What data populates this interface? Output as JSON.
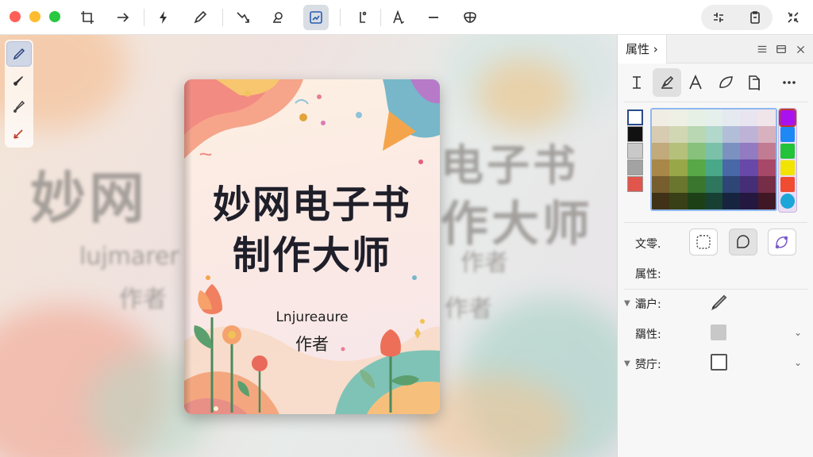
{
  "toolbar": {
    "buttons": [
      "crop-icon",
      "arrow-right-icon",
      "lightning-icon",
      "pen-icon",
      "arrow-corner-icon",
      "eraser-icon",
      "shape-tool-icon",
      "measure-icon",
      "text-style-icon",
      "line-icon",
      "mask-icon"
    ],
    "active": "shape-tool-icon",
    "right_segment": [
      "adjust-icon",
      "clipboard-icon"
    ],
    "close_icon": "collapse-icon"
  },
  "left_tools": [
    "brush-tool-icon",
    "thin-brush-icon",
    "airbrush-icon",
    "pen-nib-icon"
  ],
  "book": {
    "title_line1": "妙网电子书",
    "title_line2": "制作大师",
    "author_latin": "Lnjureaure",
    "author": "作者"
  },
  "background_echo": {
    "title_left": "妙网",
    "title_right_top": "电子书",
    "title_right_bottom": "作大师",
    "sub_left": "lujmarer",
    "sub_right": "作者",
    "sub_left2": "作者",
    "sub_right2": "作者"
  },
  "panel": {
    "tab_label": "属性 ›",
    "header_icons": [
      "menu-icon",
      "close-panel-icon"
    ],
    "tools": [
      "text-cursor-icon",
      "paint-tool-icon",
      "font-icon",
      "leaf-shape-icon",
      "page-icon",
      "more-icon"
    ],
    "active_tool": "paint-tool-icon",
    "text_label": "文零.",
    "attr_label": "属性:",
    "section1_label": "灞户:",
    "section2_label": "羂性:",
    "section3_label": "赟庁:",
    "swatches": [
      "#ffffff",
      "#111111",
      "#c9c9c9",
      "#a3a3a3",
      "#e0564c"
    ],
    "hues": [
      "#a912f0",
      "#1e88f5",
      "#22c33a",
      "#f0e400",
      "#f04c32",
      "#1aa6d8"
    ]
  }
}
